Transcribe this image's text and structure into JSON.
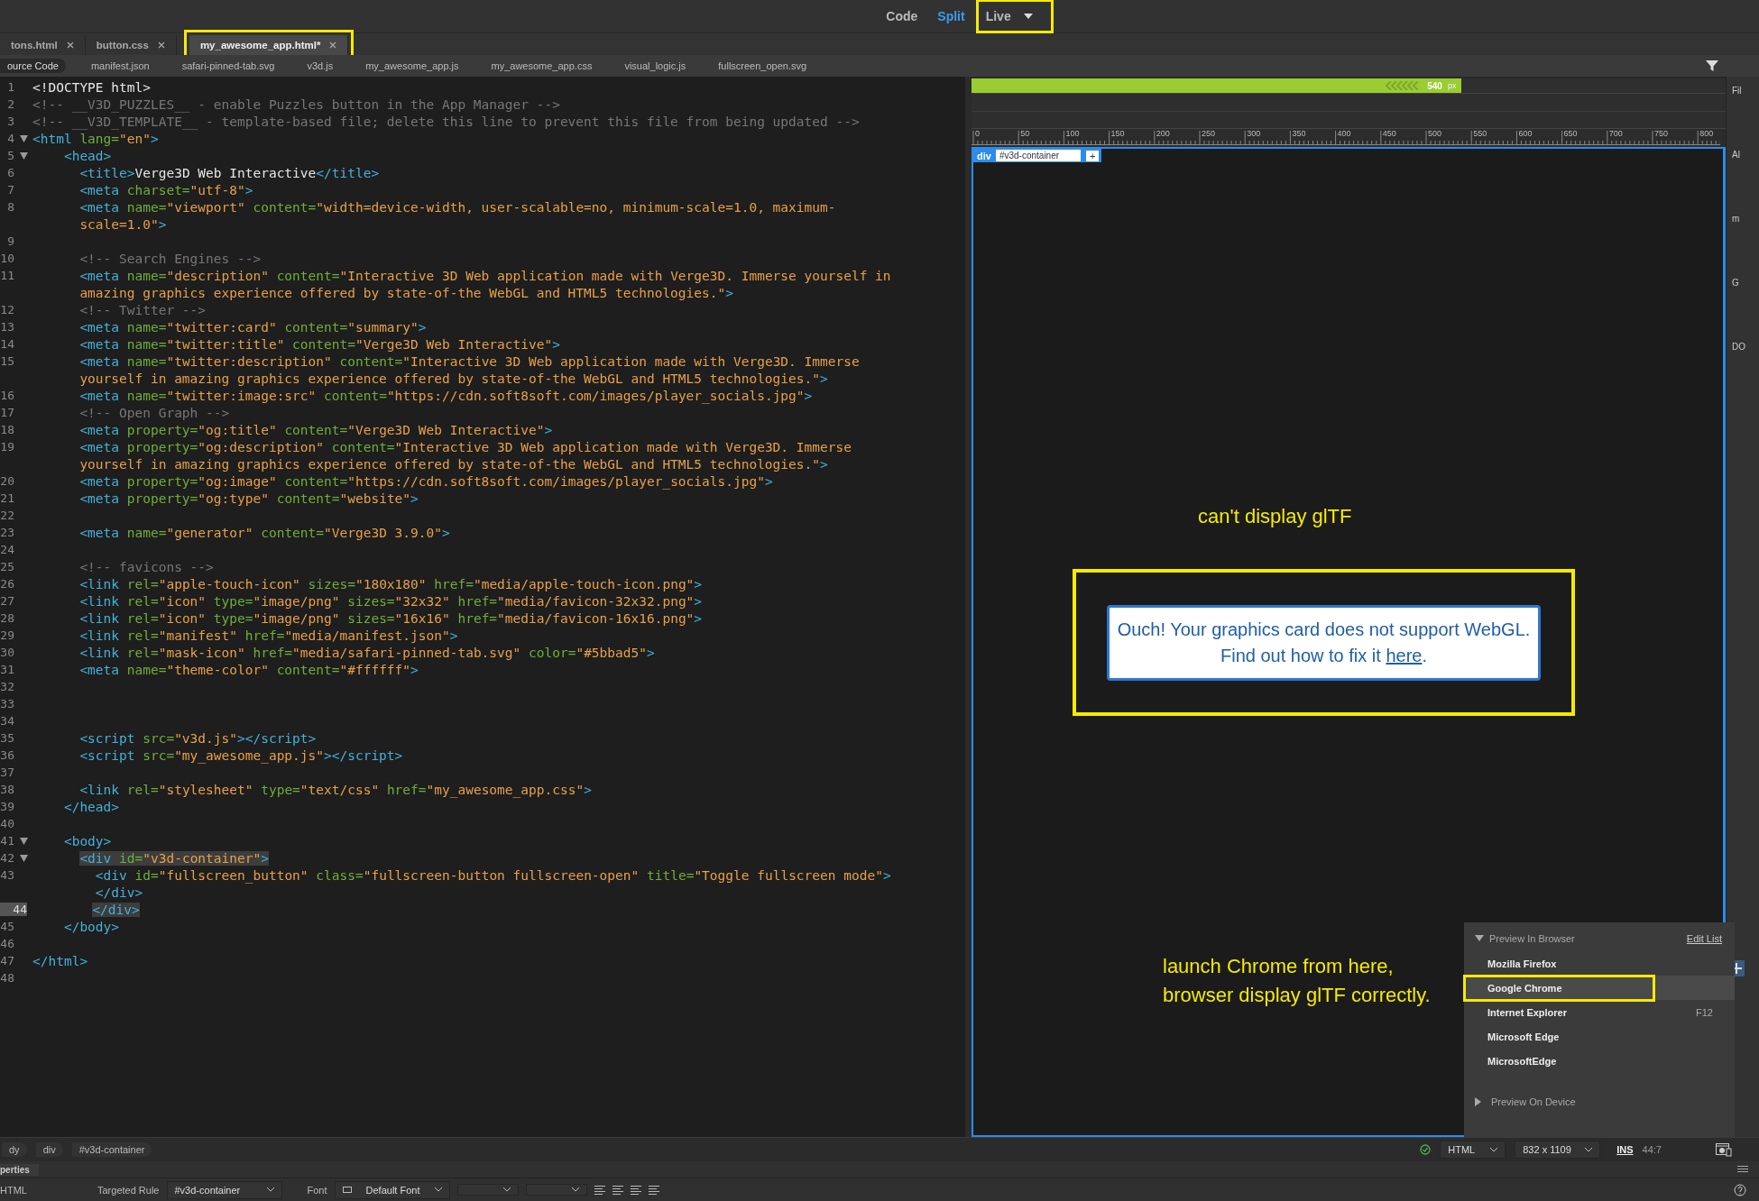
{
  "views": [
    {
      "label": "Code",
      "selected": false,
      "highlighted": false,
      "dropdown": false
    },
    {
      "label": "Split",
      "selected": true,
      "highlighted": false,
      "dropdown": false
    },
    {
      "label": "Live",
      "selected": false,
      "highlighted": true,
      "dropdown": true
    }
  ],
  "tabs": [
    {
      "label": "tons.html",
      "selected": false,
      "highlighted": false
    },
    {
      "label": "button.css",
      "selected": false,
      "highlighted": false
    },
    {
      "label": "my_awesome_app.html*",
      "selected": true,
      "highlighted": true
    }
  ],
  "related_files": [
    {
      "label": "ource Code",
      "selected": true
    },
    {
      "label": "manifest.json",
      "selected": false
    },
    {
      "label": "safari-pinned-tab.svg",
      "selected": false
    },
    {
      "label": "v3d.js",
      "selected": false
    },
    {
      "label": "my_awesome_app.js",
      "selected": false
    },
    {
      "label": "my_awesome_app.css",
      "selected": false
    },
    {
      "label": "visual_logic.js",
      "selected": false
    },
    {
      "label": "fullscreen_open.svg",
      "selected": false
    }
  ],
  "code": [
    {
      "n": "1",
      "parts": [
        {
          "kind": "text",
          "text": "<!DOCTYPE html>"
        }
      ]
    },
    {
      "n": "2",
      "parts": [
        {
          "kind": "comment",
          "text": "<!-- __V3D_PUZZLES__ - enable Puzzles button in the App Manager -->"
        }
      ]
    },
    {
      "n": "3",
      "parts": [
        {
          "kind": "comment",
          "text": "<!-- __V3D_TEMPLATE__ - template-based file; delete this line to prevent this file from being updated -->"
        }
      ]
    },
    {
      "n": "4",
      "expanded": true,
      "parts": [
        {
          "kind": "tag",
          "text": "<html "
        },
        {
          "kind": "attr",
          "text": "lang="
        },
        {
          "kind": "value",
          "text": "\"en\""
        },
        {
          "kind": "tag",
          "text": ">"
        }
      ]
    },
    {
      "n": "5",
      "expanded": true,
      "parts": [
        {
          "kind": "tag",
          "text": "    <head>"
        }
      ]
    },
    {
      "n": "6",
      "parts": [
        {
          "kind": "tag",
          "text": "      <title>"
        },
        {
          "kind": "text",
          "text": "Verge3D Web Interactive"
        },
        {
          "kind": "tag",
          "text": "</title>"
        }
      ]
    },
    {
      "n": "7",
      "parts": [
        {
          "kind": "tag",
          "text": "      <meta "
        },
        {
          "kind": "attr",
          "text": "charset="
        },
        {
          "kind": "value",
          "text": "\"utf-8\""
        },
        {
          "kind": "tag",
          "text": ">"
        }
      ]
    },
    {
      "n": "8",
      "parts": [
        {
          "kind": "tag",
          "text": "      <meta "
        },
        {
          "kind": "attr",
          "text": "name="
        },
        {
          "kind": "value",
          "text": "\"viewport\" "
        },
        {
          "kind": "attr",
          "text": "content="
        },
        {
          "kind": "value",
          "text": "\"width=device-width, user-scalable=no, minimum-scale=1.0, maximum-"
        }
      ]
    },
    {
      "parts": [
        {
          "kind": "value",
          "text": "      scale=1.0\""
        },
        {
          "kind": "tag",
          "text": ">"
        }
      ]
    },
    {
      "n": "9"
    },
    {
      "n": "10",
      "parts": [
        {
          "kind": "comment",
          "text": "      <!-- Search Engines -->"
        }
      ]
    },
    {
      "n": "11",
      "parts": [
        {
          "kind": "tag",
          "text": "      <meta "
        },
        {
          "kind": "attr",
          "text": "name="
        },
        {
          "kind": "value",
          "text": "\"description\" "
        },
        {
          "kind": "attr",
          "text": "content="
        },
        {
          "kind": "value",
          "text": "\"Interactive 3D Web application made with Verge3D. Immerse yourself in"
        }
      ]
    },
    {
      "parts": [
        {
          "kind": "value",
          "text": "      amazing graphics experience offered by state-of-the WebGL and HTML5 technologies.\""
        },
        {
          "kind": "tag",
          "text": ">"
        }
      ]
    },
    {
      "n": "12",
      "parts": [
        {
          "kind": "comment",
          "text": "      <!-- Twitter -->"
        }
      ]
    },
    {
      "n": "13",
      "parts": [
        {
          "kind": "tag",
          "text": "      <meta "
        },
        {
          "kind": "attr",
          "text": "name="
        },
        {
          "kind": "value",
          "text": "\"twitter:card\" "
        },
        {
          "kind": "attr",
          "text": "content="
        },
        {
          "kind": "value",
          "text": "\"summary\""
        },
        {
          "kind": "tag",
          "text": ">"
        }
      ]
    },
    {
      "n": "14",
      "parts": [
        {
          "kind": "tag",
          "text": "      <meta "
        },
        {
          "kind": "attr",
          "text": "name="
        },
        {
          "kind": "value",
          "text": "\"twitter:title\" "
        },
        {
          "kind": "attr",
          "text": "content="
        },
        {
          "kind": "value",
          "text": "\"Verge3D Web Interactive\""
        },
        {
          "kind": "tag",
          "text": ">"
        }
      ]
    },
    {
      "n": "15",
      "parts": [
        {
          "kind": "tag",
          "text": "      <meta "
        },
        {
          "kind": "attr",
          "text": "name="
        },
        {
          "kind": "value",
          "text": "\"twitter:description\" "
        },
        {
          "kind": "attr",
          "text": "content="
        },
        {
          "kind": "value",
          "text": "\"Interactive 3D Web application made with Verge3D. Immerse"
        }
      ]
    },
    {
      "parts": [
        {
          "kind": "value",
          "text": "      yourself in amazing graphics experience offered by state-of-the WebGL and HTML5 technologies.\""
        },
        {
          "kind": "tag",
          "text": ">"
        }
      ]
    },
    {
      "n": "16",
      "parts": [
        {
          "kind": "tag",
          "text": "      <meta "
        },
        {
          "kind": "attr",
          "text": "name="
        },
        {
          "kind": "value",
          "text": "\"twitter:image:src\" "
        },
        {
          "kind": "attr",
          "text": "content="
        },
        {
          "kind": "value",
          "text": "\"https://cdn.soft8soft.com/images/player_socials.jpg\""
        },
        {
          "kind": "tag",
          "text": ">"
        }
      ]
    },
    {
      "n": "17",
      "parts": [
        {
          "kind": "comment",
          "text": "      <!-- Open Graph -->"
        }
      ]
    },
    {
      "n": "18",
      "parts": [
        {
          "kind": "tag",
          "text": "      <meta "
        },
        {
          "kind": "attr",
          "text": "property="
        },
        {
          "kind": "value",
          "text": "\"og:title\" "
        },
        {
          "kind": "attr",
          "text": "content="
        },
        {
          "kind": "value",
          "text": "\"Verge3D Web Interactive\""
        },
        {
          "kind": "tag",
          "text": ">"
        }
      ]
    },
    {
      "n": "19",
      "parts": [
        {
          "kind": "tag",
          "text": "      <meta "
        },
        {
          "kind": "attr",
          "text": "property="
        },
        {
          "kind": "value",
          "text": "\"og:description\" "
        },
        {
          "kind": "attr",
          "text": "content="
        },
        {
          "kind": "value",
          "text": "\"Interactive 3D Web application made with Verge3D. Immerse"
        }
      ]
    },
    {
      "parts": [
        {
          "kind": "value",
          "text": "      yourself in amazing graphics experience offered by state-of-the WebGL and HTML5 technologies.\""
        },
        {
          "kind": "tag",
          "text": ">"
        }
      ]
    },
    {
      "n": "20",
      "parts": [
        {
          "kind": "tag",
          "text": "      <meta "
        },
        {
          "kind": "attr",
          "text": "property="
        },
        {
          "kind": "value",
          "text": "\"og:image\" "
        },
        {
          "kind": "attr",
          "text": "content="
        },
        {
          "kind": "value",
          "text": "\"https://cdn.soft8soft.com/images/player_socials.jpg\""
        },
        {
          "kind": "tag",
          "text": ">"
        }
      ]
    },
    {
      "n": "21",
      "parts": [
        {
          "kind": "tag",
          "text": "      <meta "
        },
        {
          "kind": "attr",
          "text": "property="
        },
        {
          "kind": "value",
          "text": "\"og:type\" "
        },
        {
          "kind": "attr",
          "text": "content="
        },
        {
          "kind": "value",
          "text": "\"website\""
        },
        {
          "kind": "tag",
          "text": ">"
        }
      ]
    },
    {
      "n": "22"
    },
    {
      "n": "23",
      "parts": [
        {
          "kind": "tag",
          "text": "      <meta "
        },
        {
          "kind": "attr",
          "text": "name="
        },
        {
          "kind": "value",
          "text": "\"generator\" "
        },
        {
          "kind": "attr",
          "text": "content="
        },
        {
          "kind": "value",
          "text": "\"Verge3D 3.9.0\""
        },
        {
          "kind": "tag",
          "text": ">"
        }
      ]
    },
    {
      "n": "24"
    },
    {
      "n": "25",
      "parts": [
        {
          "kind": "comment",
          "text": "      <!-- favicons -->"
        }
      ]
    },
    {
      "n": "26",
      "parts": [
        {
          "kind": "tag",
          "text": "      <link "
        },
        {
          "kind": "attr",
          "text": "rel="
        },
        {
          "kind": "value",
          "text": "\"apple-touch-icon\" "
        },
        {
          "kind": "attr",
          "text": "sizes="
        },
        {
          "kind": "value",
          "text": "\"180x180\" "
        },
        {
          "kind": "attr",
          "text": "href="
        },
        {
          "kind": "value",
          "text": "\"media/apple-touch-icon.png\""
        },
        {
          "kind": "tag",
          "text": ">"
        }
      ]
    },
    {
      "n": "27",
      "parts": [
        {
          "kind": "tag",
          "text": "      <link "
        },
        {
          "kind": "attr",
          "text": "rel="
        },
        {
          "kind": "value",
          "text": "\"icon\" "
        },
        {
          "kind": "attr",
          "text": "type="
        },
        {
          "kind": "value",
          "text": "\"image/png\" "
        },
        {
          "kind": "attr",
          "text": "sizes="
        },
        {
          "kind": "value",
          "text": "\"32x32\" "
        },
        {
          "kind": "attr",
          "text": "href="
        },
        {
          "kind": "value",
          "text": "\"media/favicon-32x32.png\""
        },
        {
          "kind": "tag",
          "text": ">"
        }
      ]
    },
    {
      "n": "28",
      "parts": [
        {
          "kind": "tag",
          "text": "      <link "
        },
        {
          "kind": "attr",
          "text": "rel="
        },
        {
          "kind": "value",
          "text": "\"icon\" "
        },
        {
          "kind": "attr",
          "text": "type="
        },
        {
          "kind": "value",
          "text": "\"image/png\" "
        },
        {
          "kind": "attr",
          "text": "sizes="
        },
        {
          "kind": "value",
          "text": "\"16x16\" "
        },
        {
          "kind": "attr",
          "text": "href="
        },
        {
          "kind": "value",
          "text": "\"media/favicon-16x16.png\""
        },
        {
          "kind": "tag",
          "text": ">"
        }
      ]
    },
    {
      "n": "29",
      "parts": [
        {
          "kind": "tag",
          "text": "      <link "
        },
        {
          "kind": "attr",
          "text": "rel="
        },
        {
          "kind": "value",
          "text": "\"manifest\" "
        },
        {
          "kind": "attr",
          "text": "href="
        },
        {
          "kind": "value",
          "text": "\"media/manifest.json\""
        },
        {
          "kind": "tag",
          "text": ">"
        }
      ]
    },
    {
      "n": "30",
      "parts": [
        {
          "kind": "tag",
          "text": "      <link "
        },
        {
          "kind": "attr",
          "text": "rel="
        },
        {
          "kind": "value",
          "text": "\"mask-icon\" "
        },
        {
          "kind": "attr",
          "text": "href="
        },
        {
          "kind": "value",
          "text": "\"media/safari-pinned-tab.svg\" "
        },
        {
          "kind": "attr",
          "text": "color="
        },
        {
          "kind": "value",
          "text": "\"#5bbad5\""
        },
        {
          "kind": "tag",
          "text": ">"
        }
      ]
    },
    {
      "n": "31",
      "parts": [
        {
          "kind": "tag",
          "text": "      <meta "
        },
        {
          "kind": "attr",
          "text": "name="
        },
        {
          "kind": "value",
          "text": "\"theme-color\" "
        },
        {
          "kind": "attr",
          "text": "content="
        },
        {
          "kind": "value",
          "text": "\"#ffffff\""
        },
        {
          "kind": "tag",
          "text": ">"
        }
      ]
    },
    {
      "n": "32"
    },
    {
      "n": "33"
    },
    {
      "n": "34"
    },
    {
      "n": "35",
      "parts": [
        {
          "kind": "tag",
          "text": "      <script "
        },
        {
          "kind": "attr",
          "text": "src="
        },
        {
          "kind": "value",
          "text": "\"v3d.js\""
        },
        {
          "kind": "tag",
          "text": "></script>"
        }
      ]
    },
    {
      "n": "36",
      "parts": [
        {
          "kind": "tag",
          "text": "      <script "
        },
        {
          "kind": "attr",
          "text": "src="
        },
        {
          "kind": "value",
          "text": "\"my_awesome_app.js\""
        },
        {
          "kind": "tag",
          "text": "></script>"
        }
      ]
    },
    {
      "n": "37"
    },
    {
      "n": "38",
      "parts": [
        {
          "kind": "tag",
          "text": "      <link "
        },
        {
          "kind": "attr",
          "text": "rel="
        },
        {
          "kind": "value",
          "text": "\"stylesheet\" "
        },
        {
          "kind": "attr",
          "text": "type="
        },
        {
          "kind": "value",
          "text": "\"text/css\" "
        },
        {
          "kind": "attr",
          "text": "href="
        },
        {
          "kind": "value",
          "text": "\"my_awesome_app.css\""
        },
        {
          "kind": "tag",
          "text": ">"
        }
      ]
    },
    {
      "n": "39",
      "parts": [
        {
          "kind": "tag",
          "text": "    </head>"
        }
      ]
    },
    {
      "n": "40"
    },
    {
      "n": "41",
      "expanded": true,
      "parts": [
        {
          "kind": "tag",
          "text": "    <body>"
        }
      ]
    },
    {
      "n": "42",
      "expanded": true,
      "parts": [
        {
          "kind": "tag",
          "text": "      <div ",
          "highlighted": true
        },
        {
          "kind": "attr",
          "text": "id=",
          "highlighted": true
        },
        {
          "kind": "value",
          "text": "\"v3d-container\"",
          "highlighted": true
        },
        {
          "kind": "tag",
          "text": ">",
          "highlighted": true
        }
      ]
    },
    {
      "n": "43",
      "parts": [
        {
          "kind": "tag",
          "text": "        <div "
        },
        {
          "kind": "attr",
          "text": "id="
        },
        {
          "kind": "value",
          "text": "\"fullscreen_button\" "
        },
        {
          "kind": "attr",
          "text": "class="
        },
        {
          "kind": "value",
          "text": "\"fullscreen-button fullscreen-open\" "
        },
        {
          "kind": "attr",
          "text": "title="
        },
        {
          "kind": "value",
          "text": "\"Toggle fullscreen mode\""
        },
        {
          "kind": "tag",
          "text": ">"
        }
      ]
    },
    {
      "parts": [
        {
          "kind": "tag",
          "text": "        </div>"
        }
      ]
    },
    {
      "n": "44",
      "current": true,
      "parts": [
        {
          "kind": "tag",
          "text": "      </div>",
          "highlighted": true
        }
      ]
    },
    {
      "n": "45",
      "parts": [
        {
          "kind": "tag",
          "text": "    </body>"
        }
      ]
    },
    {
      "n": "46"
    },
    {
      "n": "47",
      "parts": [
        {
          "kind": "tag",
          "text": "</html>"
        }
      ]
    },
    {
      "n": "48"
    }
  ],
  "preview": {
    "width_bar": {
      "value": "540",
      "unit": "px",
      "level": 0.65
    },
    "ruler": [
      "0",
      "50",
      "100",
      "150",
      "200",
      "250",
      "300",
      "350",
      "400",
      "450",
      "500",
      "550",
      "600",
      "650",
      "700",
      "750",
      "800"
    ],
    "element_tag": {
      "tag": "div",
      "selector": "#v3d-container",
      "add": "+"
    },
    "note_top": "can't display glTF",
    "message": {
      "line1": "Ouch! Your graphics card does not support WebGL.",
      "line2": "Find out how to fix it ",
      "link": "here",
      "end": ".",
      "highlighted": true
    },
    "note_bottom": [
      "launch Chrome from here,",
      "browser display glTF correctly."
    ]
  },
  "preview_menu": {
    "title": "Preview In Browser",
    "expanded": true,
    "edit": "Edit List",
    "items": [
      {
        "label": "Mozilla Firefox",
        "selected": false,
        "highlighted": false
      },
      {
        "label": "Google Chrome",
        "selected": true,
        "highlighted": true
      },
      {
        "label": "Internet Explorer",
        "shortcut": "F12",
        "selected": false,
        "highlighted": false
      },
      {
        "label": "Microsoft Edge",
        "selected": false,
        "highlighted": false
      },
      {
        "label": "MicrosoftEdge",
        "selected": false,
        "highlighted": false
      }
    ],
    "device": {
      "label": "Preview On Device",
      "expanded": false
    }
  },
  "side_strip": [
    "Fil",
    "Al",
    "m",
    "G",
    "DO"
  ],
  "status_bar": {
    "path": [
      "dy",
      "div",
      "#v3d-container"
    ],
    "doc_type": "HTML",
    "size": "832 x 1109",
    "mode": "INS",
    "position": "44:7"
  },
  "properties": {
    "tab": "perties",
    "kind": "HTML",
    "rule_label": "Targeted Rule",
    "rule": "#v3d-container",
    "font_label": "Font",
    "font": "Default Font"
  }
}
